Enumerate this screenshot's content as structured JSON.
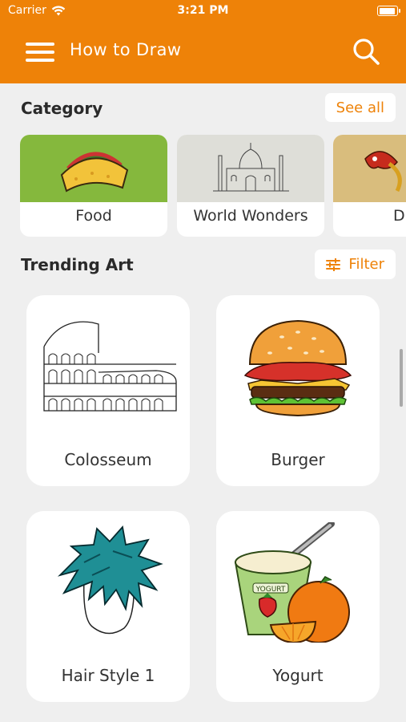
{
  "status_bar": {
    "carrier": "Carrier",
    "time": "3:21 PM"
  },
  "navbar": {
    "title": "How to Draw",
    "menu_icon": "hamburger-menu-icon",
    "search_icon": "magnifier-icon"
  },
  "category": {
    "title": "Category",
    "see_all_label": "See all",
    "items": [
      {
        "label": "Food",
        "bg": "#85b83d"
      },
      {
        "label": "World Wonders",
        "bg": "#deded8"
      },
      {
        "label": "Dra",
        "bg": "#d9bd7d"
      }
    ]
  },
  "trending": {
    "title": "Trending Art",
    "filter_label": "Filter",
    "filter_icon": "sliders-icon",
    "items": [
      {
        "label": "Colosseum"
      },
      {
        "label": "Burger"
      },
      {
        "label": "Hair Style 1"
      },
      {
        "label": "Yogurt"
      }
    ]
  },
  "colors": {
    "brand": "#ee8208",
    "background": "#efefef",
    "card": "#ffffff"
  }
}
